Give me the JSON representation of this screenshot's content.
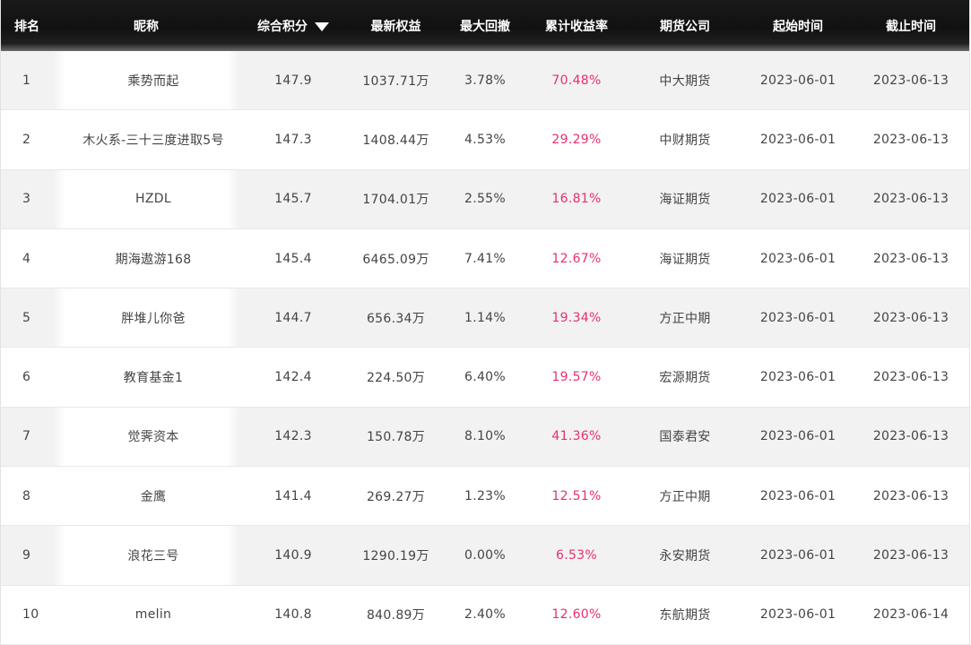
{
  "header": {
    "rank": "排名",
    "name": "昵称",
    "score": "综合积分",
    "equity": "最新权益",
    "drawdown": "最大回撤",
    "cumulative_return": "累计收益率",
    "company": "期货公司",
    "start_date": "起始时间",
    "end_date": "截止时间"
  },
  "sort": {
    "column": "score",
    "direction": "desc",
    "icon": "caret-down-icon"
  },
  "colors": {
    "header_bg": "#111111",
    "header_text": "#ffffff",
    "row_alt_bg": "#f2f2f2",
    "return_color": "#e8306a",
    "text_color": "#444444"
  },
  "rows": [
    {
      "rank": "1",
      "name": "乘势而起",
      "score": "147.9",
      "equity": "1037.71万",
      "drawdown": "3.78%",
      "return": "70.48%",
      "company": "中大期货",
      "start": "2023-06-01",
      "end": "2023-06-13"
    },
    {
      "rank": "2",
      "name": "木火系-三十三度进取5号",
      "score": "147.3",
      "equity": "1408.44万",
      "drawdown": "4.53%",
      "return": "29.29%",
      "company": "中财期货",
      "start": "2023-06-01",
      "end": "2023-06-13"
    },
    {
      "rank": "3",
      "name": "HZDL",
      "score": "145.7",
      "equity": "1704.01万",
      "drawdown": "2.55%",
      "return": "16.81%",
      "company": "海证期货",
      "start": "2023-06-01",
      "end": "2023-06-13"
    },
    {
      "rank": "4",
      "name": "期海遨游168",
      "score": "145.4",
      "equity": "6465.09万",
      "drawdown": "7.41%",
      "return": "12.67%",
      "company": "海证期货",
      "start": "2023-06-01",
      "end": "2023-06-13"
    },
    {
      "rank": "5",
      "name": "胖堆儿你爸",
      "score": "144.7",
      "equity": "656.34万",
      "drawdown": "1.14%",
      "return": "19.34%",
      "company": "方正中期",
      "start": "2023-06-01",
      "end": "2023-06-13"
    },
    {
      "rank": "6",
      "name": "教育基金1",
      "score": "142.4",
      "equity": "224.50万",
      "drawdown": "6.40%",
      "return": "19.57%",
      "company": "宏源期货",
      "start": "2023-06-01",
      "end": "2023-06-13"
    },
    {
      "rank": "7",
      "name": "觉霁资本",
      "score": "142.3",
      "equity": "150.78万",
      "drawdown": "8.10%",
      "return": "41.36%",
      "company": "国泰君安",
      "start": "2023-06-01",
      "end": "2023-06-13"
    },
    {
      "rank": "8",
      "name": "金鹰",
      "score": "141.4",
      "equity": "269.27万",
      "drawdown": "1.23%",
      "return": "12.51%",
      "company": "方正中期",
      "start": "2023-06-01",
      "end": "2023-06-13"
    },
    {
      "rank": "9",
      "name": "浪花三号",
      "score": "140.9",
      "equity": "1290.19万",
      "drawdown": "0.00%",
      "return": "6.53%",
      "company": "永安期货",
      "start": "2023-06-01",
      "end": "2023-06-13"
    },
    {
      "rank": "10",
      "name": "melin",
      "score": "140.8",
      "equity": "840.89万",
      "drawdown": "2.40%",
      "return": "12.60%",
      "company": "东航期货",
      "start": "2023-06-01",
      "end": "2023-06-14"
    }
  ]
}
